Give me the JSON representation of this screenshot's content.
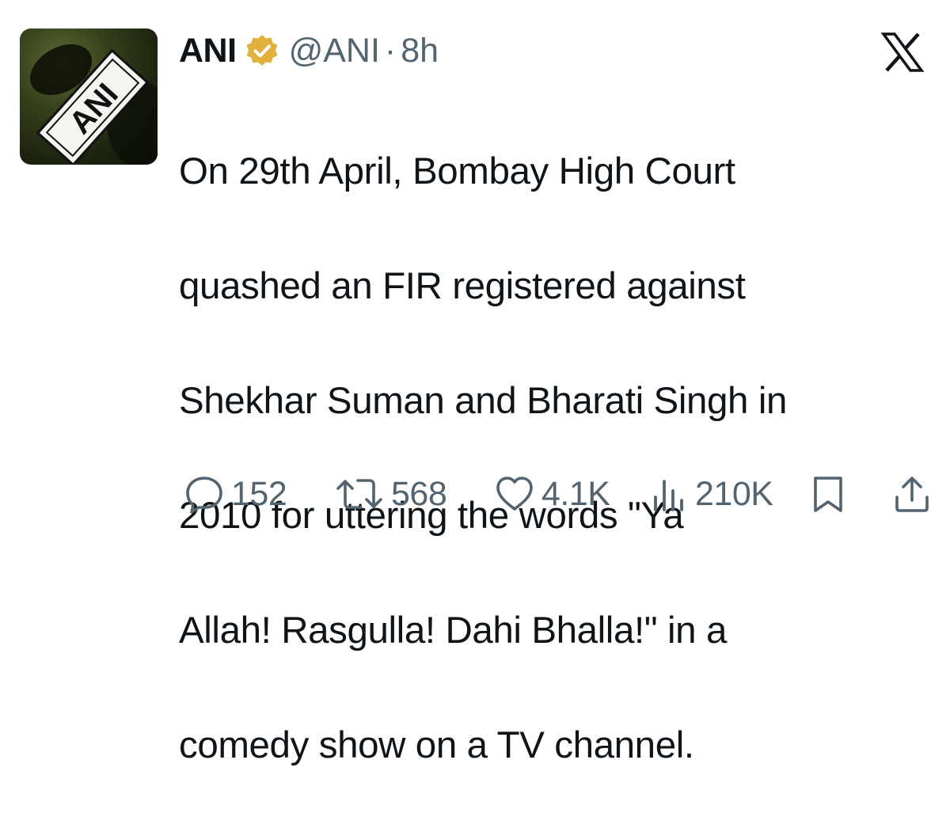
{
  "tweet": {
    "author": {
      "display_name": "ANI",
      "handle": "@ANI",
      "separator": "·",
      "time": "8h",
      "avatar_text": "ANI"
    },
    "text_lines": [
      "On 29th April, Bombay High Court",
      "quashed an FIR registered against",
      "Shekhar Suman and Bharati Singh in",
      "2010 for uttering the words \"Ya",
      "Allah! Rasgulla! Dahi Bhalla!\" in a",
      "comedy show on a TV channel."
    ],
    "metrics": {
      "replies": "152",
      "reposts": "568",
      "likes": "4.1K",
      "views": "210K"
    }
  },
  "icons": {
    "verified": "verified-badge-icon",
    "platform": "x-logo-icon",
    "reply": "reply-icon",
    "repost": "repost-icon",
    "like": "heart-icon",
    "views": "views-bar-icon",
    "bookmark": "bookmark-icon",
    "share": "share-icon"
  },
  "colors": {
    "text": "#0f1419",
    "secondary": "#536471",
    "verified_gold": "#e2b13c"
  }
}
